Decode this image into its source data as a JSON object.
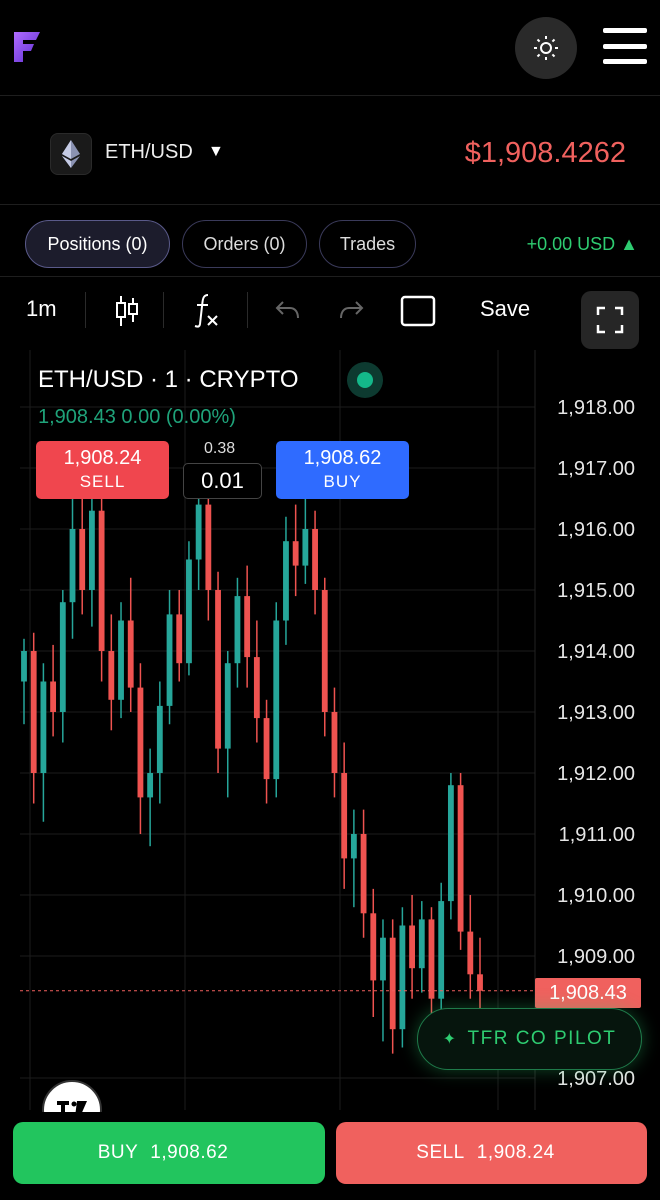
{
  "header": {
    "logo_icon": "brand-f-logo-icon",
    "theme_icon": "sun-icon",
    "menu_icon": "hamburger-menu-icon"
  },
  "pair": {
    "icon": "ethereum-icon",
    "name": "ETH/USD",
    "caret": "▼",
    "price": "$1,908.4262",
    "price_color": "#f0615e"
  },
  "tabs": [
    {
      "label": "Positions (0)",
      "active": true
    },
    {
      "label": "Orders (0)",
      "active": false
    },
    {
      "label": "Trades",
      "active": false
    }
  ],
  "pnl": "+0.00 USD ▲",
  "toolbar": {
    "interval": "1m",
    "candle_icon": "candlestick-icon",
    "indicator_icon": "fx-indicator-icon",
    "undo_icon": "undo-icon",
    "redo_icon": "redo-icon",
    "rectangle_icon": "rectangle-icon",
    "save_label": "Save",
    "fullscreen_icon": "fullscreen-icon"
  },
  "chart_header": {
    "title": "ETH/USD · 1 · CRYPTO",
    "change": "1,908.43  0.00 (0.00%)"
  },
  "quick_trade": {
    "sell_price": "1,908.24",
    "sell_label": "SELL",
    "buy_price": "1,908.62",
    "buy_label": "BUY",
    "spread": "0.38",
    "quantity": "0.01"
  },
  "last_price_tag": "1,908.43",
  "copilot": {
    "icon": "✦",
    "label": "TFR CO PILOT"
  },
  "tv_badge": "TV",
  "bottom": {
    "buy_label": "BUY",
    "buy_price": "1,908.62",
    "sell_label": "SELL",
    "sell_price": "1,908.24"
  },
  "chart_data": {
    "type": "candlestick",
    "symbol": "ETH/USD",
    "interval": "1",
    "y_ticks": [
      "1,918.00",
      "1,917.00",
      "1,916.00",
      "1,915.00",
      "1,914.00",
      "1,913.00",
      "1,912.00",
      "1,911.00",
      "1,910.00",
      "1,909.00",
      "1,907.00"
    ],
    "ylim": [
      1906.5,
      1918.5
    ],
    "last_price": 1908.43,
    "up_color": "#26a69a",
    "down_color": "#ef5350",
    "candles": [
      [
        1913.5,
        1914.2,
        1912.8,
        1914.0
      ],
      [
        1914.0,
        1914.3,
        1911.5,
        1912.0
      ],
      [
        1912.0,
        1913.8,
        1911.2,
        1913.5
      ],
      [
        1913.5,
        1914.1,
        1912.6,
        1913.0
      ],
      [
        1913.0,
        1915.0,
        1912.5,
        1914.8
      ],
      [
        1914.8,
        1916.5,
        1914.2,
        1916.0
      ],
      [
        1916.0,
        1916.6,
        1914.6,
        1915.0
      ],
      [
        1915.0,
        1916.8,
        1914.4,
        1916.3
      ],
      [
        1916.3,
        1916.9,
        1913.5,
        1914.0
      ],
      [
        1914.0,
        1914.6,
        1912.7,
        1913.2
      ],
      [
        1913.2,
        1914.8,
        1912.9,
        1914.5
      ],
      [
        1914.5,
        1915.2,
        1913.0,
        1913.4
      ],
      [
        1913.4,
        1913.8,
        1911.0,
        1911.6
      ],
      [
        1911.6,
        1912.4,
        1910.8,
        1912.0
      ],
      [
        1912.0,
        1913.5,
        1911.5,
        1913.1
      ],
      [
        1913.1,
        1915.0,
        1912.8,
        1914.6
      ],
      [
        1914.6,
        1915.0,
        1913.5,
        1913.8
      ],
      [
        1913.8,
        1915.8,
        1913.6,
        1915.5
      ],
      [
        1915.5,
        1916.8,
        1915.0,
        1916.4
      ],
      [
        1916.4,
        1916.9,
        1914.5,
        1915.0
      ],
      [
        1915.0,
        1915.3,
        1912.0,
        1912.4
      ],
      [
        1912.4,
        1914.0,
        1911.6,
        1913.8
      ],
      [
        1913.8,
        1915.2,
        1913.4,
        1914.9
      ],
      [
        1914.9,
        1915.4,
        1913.4,
        1913.9
      ],
      [
        1913.9,
        1914.5,
        1912.5,
        1912.9
      ],
      [
        1912.9,
        1913.2,
        1911.5,
        1911.9
      ],
      [
        1911.9,
        1914.8,
        1911.6,
        1914.5
      ],
      [
        1914.5,
        1916.2,
        1914.1,
        1915.8
      ],
      [
        1915.8,
        1916.4,
        1914.9,
        1915.4
      ],
      [
        1915.4,
        1916.6,
        1915.1,
        1916.0
      ],
      [
        1916.0,
        1916.3,
        1914.6,
        1915.0
      ],
      [
        1915.0,
        1915.2,
        1912.6,
        1913.0
      ],
      [
        1913.0,
        1913.4,
        1911.6,
        1912.0
      ],
      [
        1912.0,
        1912.5,
        1910.1,
        1910.6
      ],
      [
        1910.6,
        1911.4,
        1909.8,
        1911.0
      ],
      [
        1911.0,
        1911.4,
        1909.3,
        1909.7
      ],
      [
        1909.7,
        1910.1,
        1908.0,
        1908.6
      ],
      [
        1908.6,
        1909.6,
        1907.6,
        1909.3
      ],
      [
        1909.3,
        1909.6,
        1907.4,
        1907.8
      ],
      [
        1907.8,
        1909.8,
        1907.5,
        1909.5
      ],
      [
        1909.5,
        1910.0,
        1908.3,
        1908.8
      ],
      [
        1908.8,
        1909.9,
        1908.4,
        1909.6
      ],
      [
        1909.6,
        1909.8,
        1907.9,
        1908.3
      ],
      [
        1908.3,
        1910.2,
        1908.0,
        1909.9
      ],
      [
        1909.9,
        1912.0,
        1909.6,
        1911.8
      ],
      [
        1911.8,
        1912.0,
        1909.1,
        1909.4
      ],
      [
        1909.4,
        1910.0,
        1908.3,
        1908.7
      ],
      [
        1908.7,
        1909.3,
        1908.1,
        1908.43
      ]
    ]
  }
}
